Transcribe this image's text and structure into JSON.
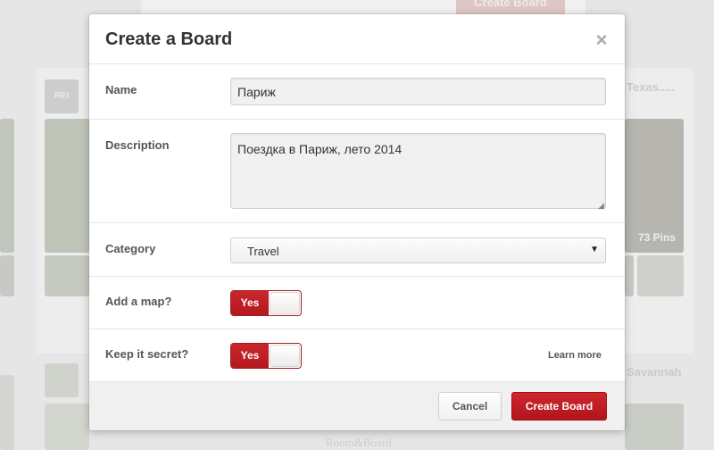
{
  "background": {
    "top_button_label": "Create Board",
    "logo_text": "REI",
    "board_titles": [
      "Texas.....",
      "Savannah"
    ],
    "pins_counts": [
      "73 Pins"
    ],
    "bottom_text": "Room&Board"
  },
  "modal": {
    "title": "Create a Board",
    "close_symbol": "×",
    "fields": {
      "name": {
        "label": "Name",
        "value": "Париж"
      },
      "description": {
        "label": "Description",
        "value": "Поездка в Париж, лето 2014"
      },
      "category": {
        "label": "Category",
        "value": "Travel"
      },
      "add_map": {
        "label": "Add a map?",
        "toggle_label": "Yes"
      },
      "secret": {
        "label": "Keep it secret?",
        "toggle_label": "Yes",
        "learn_more": "Learn more"
      }
    },
    "buttons": {
      "cancel": "Cancel",
      "create": "Create Board"
    }
  },
  "colors": {
    "accent": "#bd1e24",
    "text": "#333333",
    "muted": "#555555"
  },
  "icons": {
    "close": "close-icon",
    "dropdown": "chevron-down-icon",
    "resize": "resize-grip-icon"
  }
}
